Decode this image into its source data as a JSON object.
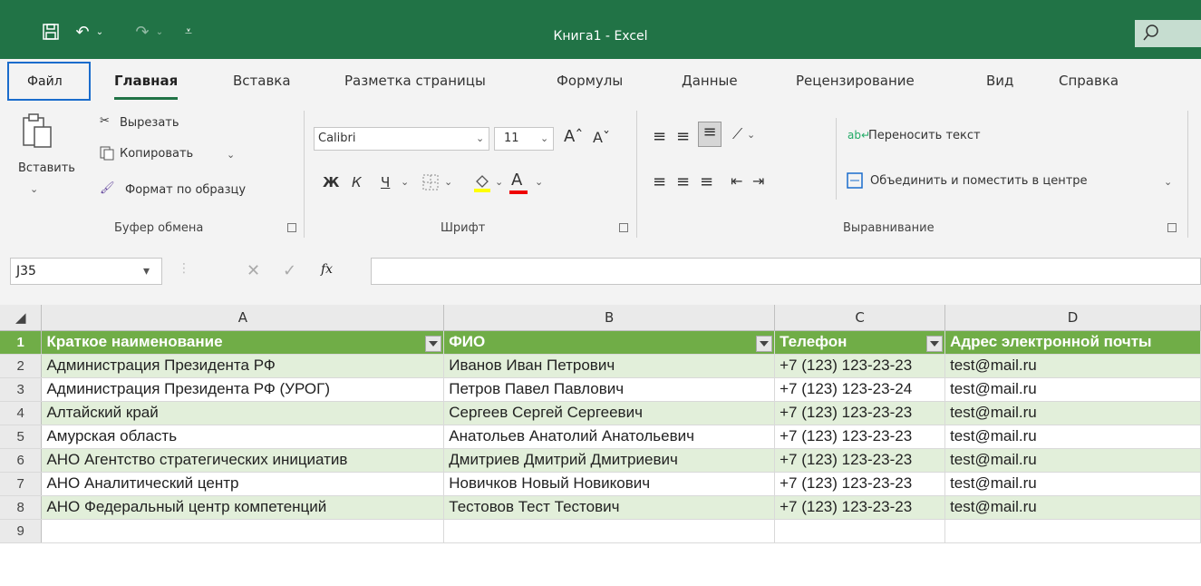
{
  "window": {
    "title": "Книга1  -  Excel"
  },
  "tabs": [
    "Файл",
    "Главная",
    "Вставка",
    "Разметка страницы",
    "Формулы",
    "Данные",
    "Рецензирование",
    "Вид",
    "Справка"
  ],
  "ribbon": {
    "clipboard": {
      "paste": "Вставить",
      "cut": "Вырезать",
      "copy": "Копировать",
      "format_painter": "Формат по образцу",
      "label": "Буфер обмена"
    },
    "font": {
      "name": "Calibri",
      "size": "11",
      "bold": "Ж",
      "italic": "К",
      "underline": "Ч",
      "label": "Шрифт"
    },
    "alignment": {
      "wrap": "Переносить текст",
      "merge": "Объединить и поместить в центре",
      "label": "Выравнивание"
    }
  },
  "formula_bar": {
    "name_box": "J35",
    "fx": "fx",
    "value": ""
  },
  "sheet": {
    "columns": [
      "A",
      "B",
      "C",
      "D"
    ],
    "header": [
      "Краткое наименование",
      "ФИО",
      "Телефон",
      "Адрес электронной почты"
    ],
    "rows": [
      [
        "Администрация Президента РФ",
        "Иванов Иван Петрович",
        "+7 (123) 123-23-23",
        "test@mail.ru"
      ],
      [
        "Администрация Президента РФ (УРОГ)",
        "Петров Павел Павлович",
        "+7 (123) 123-23-24",
        "test@mail.ru"
      ],
      [
        "Алтайский край",
        "Сергеев Сергей Сергеевич",
        "+7 (123) 123-23-23",
        "test@mail.ru"
      ],
      [
        "Амурская область",
        "Анатольев Анатолий Анатольевич",
        "+7 (123) 123-23-23",
        "test@mail.ru"
      ],
      [
        "АНО Агентство стратегических инициатив",
        "Дмитриев Дмитрий Дмитриевич",
        "+7 (123) 123-23-23",
        "test@mail.ru"
      ],
      [
        "АНО Аналитический центр",
        "Новичков Новый Новикович",
        "+7 (123) 123-23-23",
        "test@mail.ru"
      ],
      [
        "АНО Федеральный центр компетенций",
        "Тестовов Тест Тестович",
        "+7 (123) 123-23-23",
        "test@mail.ru"
      ]
    ],
    "row_numbers": [
      "1",
      "2",
      "3",
      "4",
      "5",
      "6",
      "7",
      "8",
      "9"
    ]
  },
  "colors": {
    "title_bar": "#217346",
    "table_header": "#70ad47",
    "band": "#e2efda"
  }
}
